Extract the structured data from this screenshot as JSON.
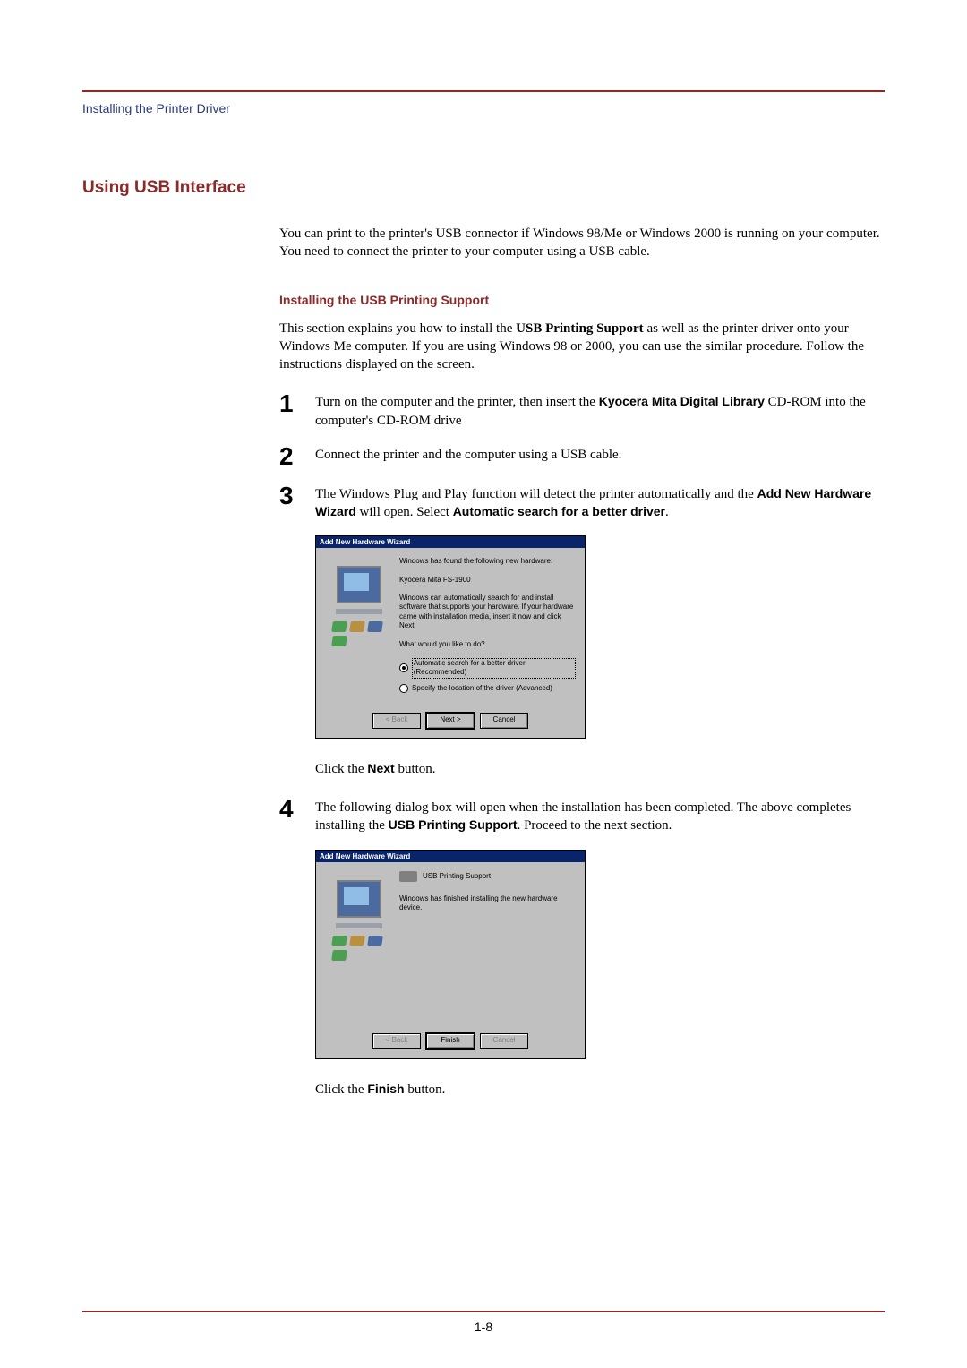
{
  "breadcrumb": "Installing the Printer Driver",
  "section_title": "Using USB Interface",
  "intro": "You can print to the printer's USB connector if Windows 98/Me or Windows 2000 is running on your computer. You need to connect the printer to your computer using a USB cable.",
  "sub_title": "Installing the USB Printing Support",
  "sub_intro_part1": "This section explains you how to install the ",
  "sub_intro_bold1": "USB Printing Support",
  "sub_intro_part2": " as well as the printer driver onto your Windows Me computer. If you are using Windows 98 or 2000, you can use the similar procedure.  Follow the instructions displayed on the screen.",
  "steps": {
    "s1": {
      "num": "1",
      "t1": "Turn on the computer and the printer, then insert the ",
      "b1": "Kyocera Mita Digital Library",
      "t2": " CD-ROM into the computer's CD-ROM drive"
    },
    "s2": {
      "num": "2",
      "t1": "Connect the printer and the computer using a USB cable."
    },
    "s3": {
      "num": "3",
      "t1": "The Windows Plug and Play function will detect the printer automatically and the ",
      "b1": "Add New Hardware Wizard",
      "t2": " will open. Select ",
      "b2": "Automatic search for a better driver",
      "t3": "."
    },
    "s4": {
      "num": "4",
      "t1": "The following dialog box will open when the installation has been completed. The above completes installing the ",
      "b1": "USB Printing Support",
      "t2": ". Proceed to the next section."
    }
  },
  "dialog1": {
    "title": "Add New Hardware Wizard",
    "line1": "Windows has found the following new hardware:",
    "device": "Kyocera Mita FS-1900",
    "line2": "Windows can automatically search for and install software that supports your hardware. If your hardware came with installation media, insert it now and click Next.",
    "prompt": "What would you like to do?",
    "opt1": "Automatic search for a better driver (Recommended)",
    "opt2": "Specify the location of the driver (Advanced)",
    "btn_back": "< Back",
    "btn_next": "Next >",
    "btn_cancel": "Cancel"
  },
  "click1_pre": "Click the ",
  "click1_bold": "Next",
  "click1_post": " button.",
  "dialog2": {
    "title": "Add New Hardware Wizard",
    "device": "USB Printing Support",
    "line1": "Windows has finished installing the new hardware device.",
    "btn_back": "< Back",
    "btn_finish": "Finish",
    "btn_cancel": "Cancel"
  },
  "click2_pre": "Click the ",
  "click2_bold": "Finish",
  "click2_post": " button.",
  "page_num": "1-8"
}
